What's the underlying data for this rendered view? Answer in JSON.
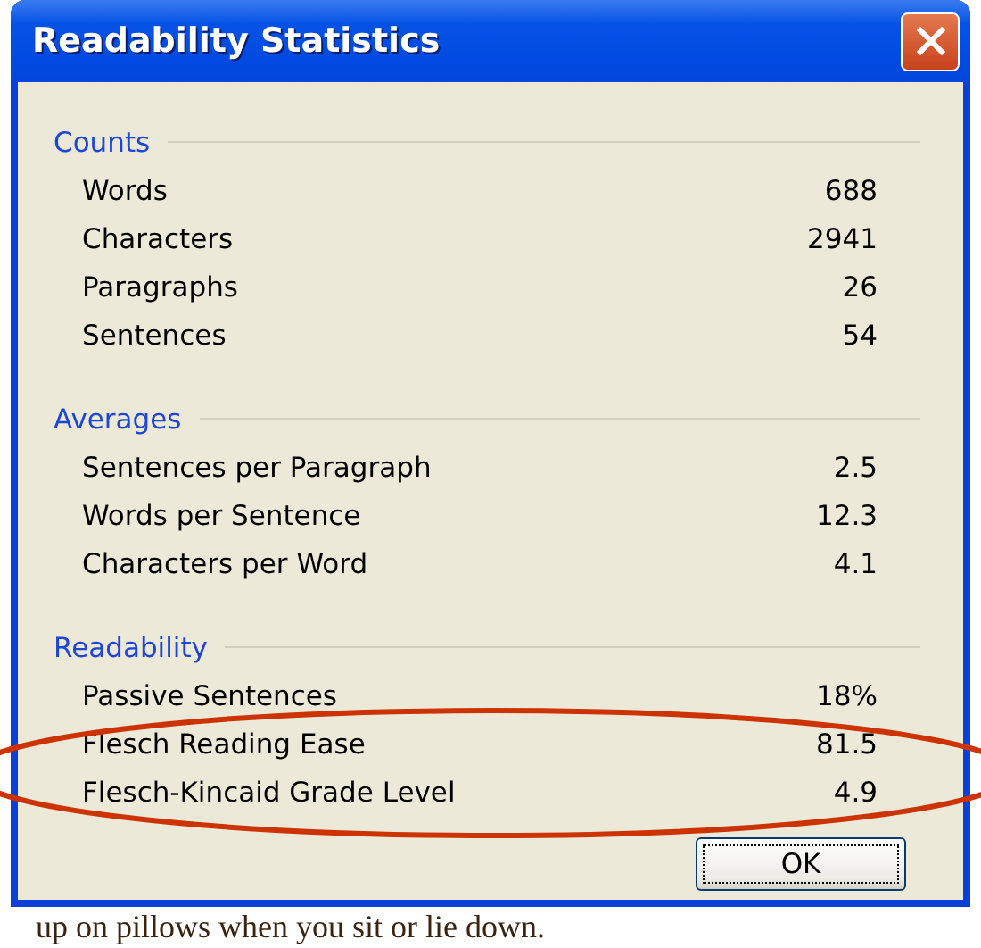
{
  "window": {
    "title": "Readability Statistics"
  },
  "sections": [
    {
      "heading": "Counts",
      "rows": [
        {
          "label": "Words",
          "value": "688"
        },
        {
          "label": "Characters",
          "value": "2941"
        },
        {
          "label": "Paragraphs",
          "value": "26"
        },
        {
          "label": "Sentences",
          "value": "54"
        }
      ]
    },
    {
      "heading": "Averages",
      "rows": [
        {
          "label": "Sentences per Paragraph",
          "value": "2.5"
        },
        {
          "label": "Words per Sentence",
          "value": "12.3"
        },
        {
          "label": "Characters per Word",
          "value": "4.1"
        }
      ]
    },
    {
      "heading": "Readability",
      "rows": [
        {
          "label": "Passive Sentences",
          "value": "18%"
        },
        {
          "label": "Flesch Reading Ease",
          "value": "81.5"
        },
        {
          "label": "Flesch-Kincaid Grade Level",
          "value": "4.9"
        }
      ]
    }
  ],
  "buttons": [
    "OK"
  ],
  "annotation": {
    "kind": "ellipse"
  },
  "document": {
    "last_line": "up on pillows when you sit or lie down."
  }
}
